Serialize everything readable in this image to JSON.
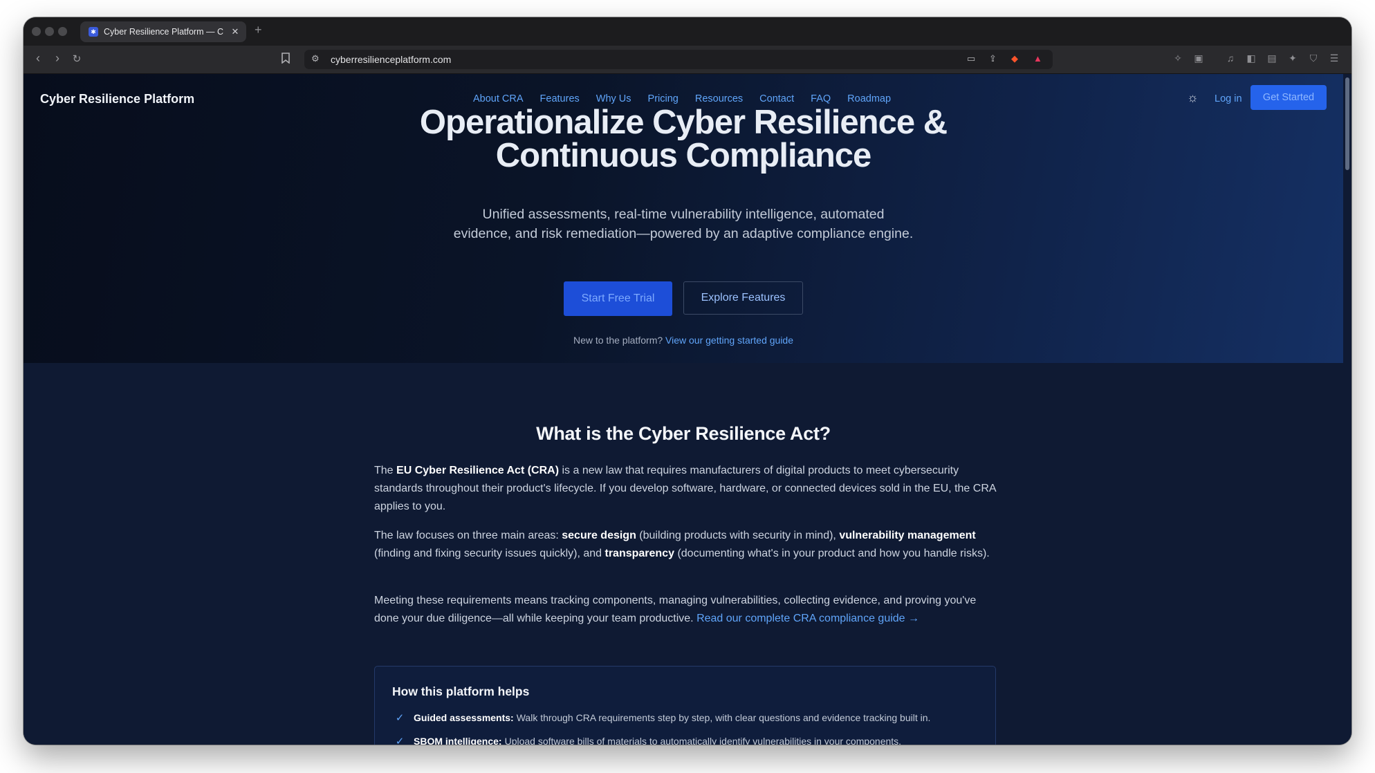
{
  "browser": {
    "tab_title": "Cyber Resilience Platform — C",
    "tab_close": "✕",
    "new_tab": "+",
    "url": "cyberresilienceplatform.com"
  },
  "site": {
    "brand": "Cyber Resilience Platform",
    "nav": [
      "About CRA",
      "Features",
      "Why Us",
      "Pricing",
      "Resources",
      "Contact",
      "FAQ",
      "Roadmap"
    ],
    "login": "Log in",
    "get_started": "Get Started",
    "theme_icon": "sun-icon"
  },
  "hero": {
    "title_line1": "Operationalize Cyber Resilience &",
    "title_line2": "Continuous Compliance",
    "subtitle_line1": "Unified assessments, real-time vulnerability intelligence, automated",
    "subtitle_line2": "evidence, and risk remediation—powered by an adaptive compliance engine.",
    "cta_primary": "Start Free Trial",
    "cta_secondary": "Explore Features",
    "newto_text": "New to the platform?",
    "newto_link": "View our getting started guide"
  },
  "cra": {
    "heading": "What is the Cyber Resilience Act?",
    "p1_a": "The ",
    "p1_b": "EU Cyber Resilience Act (CRA)",
    "p1_c": " is a new law that requires manufacturers of digital products to meet cybersecurity standards throughout their product's lifecycle. If you develop software, hardware, or connected devices sold in the EU, the CRA applies to you.",
    "p2_a": "The law focuses on three main areas: ",
    "p2_b": "secure design",
    "p2_c": " (building products with security in mind), ",
    "p2_d": "vulnerability management",
    "p2_e": " (finding and fixing security issues quickly), and ",
    "p2_f": "transparency",
    "p2_g": " (documenting what's in your product and how you handle risks).",
    "p3_a": "Meeting these requirements means tracking components, managing vulnerabilities, collecting evidence, and proving you've done your due diligence—all while keeping your team productive. ",
    "p3_link": "Read our complete CRA compliance guide →"
  },
  "helps": {
    "title": "How this platform helps",
    "items": [
      {
        "label": "Guided assessments:",
        "text": "Walk through CRA requirements step by step, with clear questions and evidence tracking built in."
      },
      {
        "label": "SBOM intelligence:",
        "text": "Upload software bills of materials to automatically identify vulnerabilities in your components."
      }
    ]
  },
  "colors": {
    "accent": "#2563eb",
    "link": "#60a5fa",
    "page_bg": "#0f1a33"
  }
}
